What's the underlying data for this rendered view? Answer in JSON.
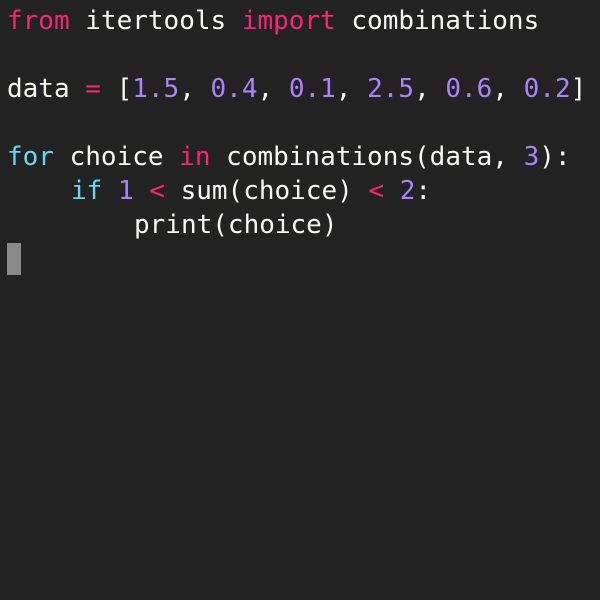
{
  "colors": {
    "background": "#232323",
    "plain": "#f8f8f2",
    "keyword_pink": "#f92672",
    "keyword_cyan": "#66d9ef",
    "number": "#ae81ff",
    "cursor": "#8a8a8a"
  },
  "code": {
    "line1": [
      {
        "text": "from",
        "color": "#f92672"
      },
      {
        "text": " itertools ",
        "color": "#f8f8f2"
      },
      {
        "text": "import",
        "color": "#f92672"
      },
      {
        "text": " combinations",
        "color": "#f8f8f2"
      }
    ],
    "line2": [
      {
        "text": "data ",
        "color": "#f8f8f2"
      },
      {
        "text": "=",
        "color": "#f92672"
      },
      {
        "text": " [",
        "color": "#f8f8f2"
      },
      {
        "text": "1.5",
        "color": "#ae81ff"
      },
      {
        "text": ", ",
        "color": "#f8f8f2"
      },
      {
        "text": "0.4",
        "color": "#ae81ff"
      },
      {
        "text": ", ",
        "color": "#f8f8f2"
      },
      {
        "text": "0.1",
        "color": "#ae81ff"
      },
      {
        "text": ", ",
        "color": "#f8f8f2"
      },
      {
        "text": "2.5",
        "color": "#ae81ff"
      },
      {
        "text": ", ",
        "color": "#f8f8f2"
      },
      {
        "text": "0.6",
        "color": "#ae81ff"
      },
      {
        "text": ", ",
        "color": "#f8f8f2"
      },
      {
        "text": "0.2",
        "color": "#ae81ff"
      },
      {
        "text": "]",
        "color": "#f8f8f2"
      }
    ],
    "line3": [
      {
        "text": "for",
        "color": "#66d9ef"
      },
      {
        "text": " choice ",
        "color": "#f8f8f2"
      },
      {
        "text": "in",
        "color": "#f92672"
      },
      {
        "text": " combinations(data, ",
        "color": "#f8f8f2"
      },
      {
        "text": "3",
        "color": "#ae81ff"
      },
      {
        "text": "):",
        "color": "#f8f8f2"
      }
    ],
    "line4": [
      {
        "text": "if",
        "color": "#66d9ef"
      },
      {
        "text": " ",
        "color": "#f8f8f2"
      },
      {
        "text": "1",
        "color": "#ae81ff"
      },
      {
        "text": " ",
        "color": "#f8f8f2"
      },
      {
        "text": "<",
        "color": "#f92672"
      },
      {
        "text": " sum(choice) ",
        "color": "#f8f8f2"
      },
      {
        "text": "<",
        "color": "#f92672"
      },
      {
        "text": " ",
        "color": "#f8f8f2"
      },
      {
        "text": "2",
        "color": "#ae81ff"
      },
      {
        "text": ":",
        "color": "#f8f8f2"
      }
    ],
    "line5": [
      {
        "text": "print(choice)",
        "color": "#f8f8f2"
      }
    ]
  }
}
